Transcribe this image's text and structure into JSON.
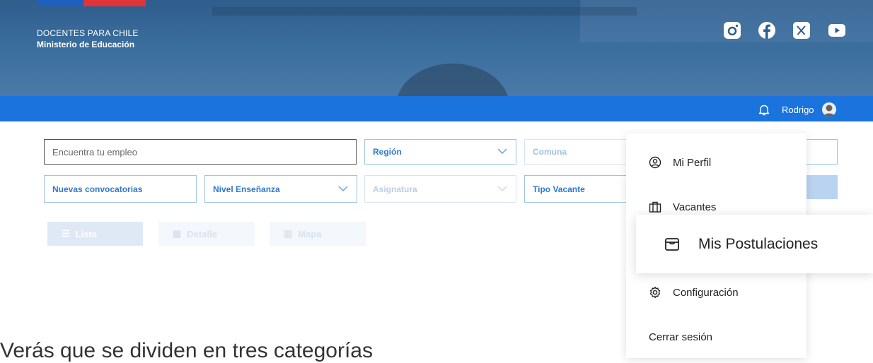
{
  "brand": {
    "line1": "DOCENTES PARA CHILE",
    "line2": "Ministerio de Educación"
  },
  "social": [
    "instagram-icon",
    "facebook-icon",
    "x-icon",
    "youtube-icon"
  ],
  "user": {
    "name": "Rodrigo"
  },
  "filters": {
    "search_placeholder": "Encuentra tu empleo",
    "region": "Región",
    "comuna": "Comuna",
    "nuevas": "Nuevas convocatorias",
    "nivel": "Nivel Enseñanza",
    "asignatura": "Asignatura",
    "tipo": "Tipo Vacante"
  },
  "views": {
    "lista": "Lista",
    "detalle": "Detalle",
    "mapa": "Mapa"
  },
  "menu": {
    "perfil": "Mi Perfil",
    "vacantes": "Vacantes",
    "postulaciones": "Mis Postulaciones",
    "config": "Configuración",
    "logout": "Cerrar sesión"
  },
  "caption": "Verás que se dividen en tres categorías",
  "colors": {
    "bar": "#1b74de",
    "accent": "#2f79d0",
    "flag_blue": "#1f5fc0",
    "flag_red": "#e0343a"
  }
}
